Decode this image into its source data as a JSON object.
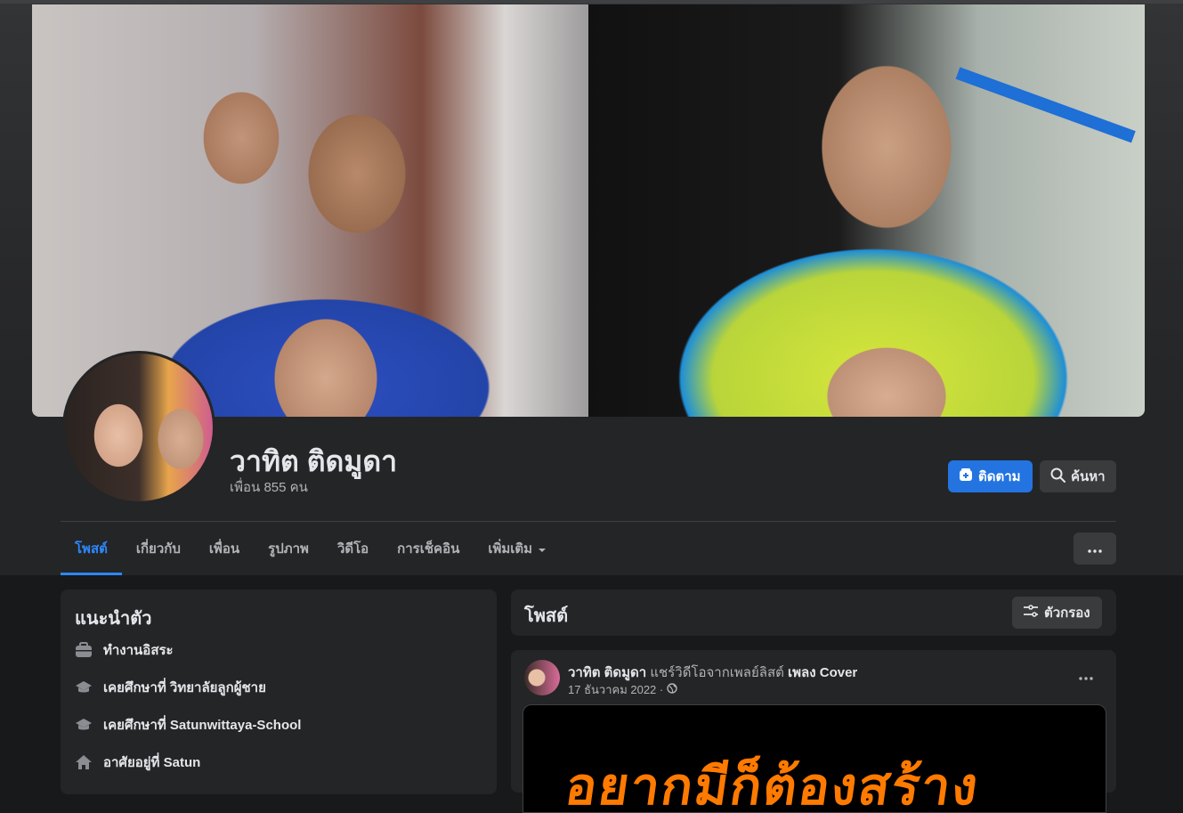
{
  "profile": {
    "name": "วาทิต ติดมูดา",
    "friends_text": "เพื่อน 855 คน"
  },
  "actions": {
    "follow_label": "ติดตาม",
    "search_label": "ค้นหา"
  },
  "tabs": [
    {
      "label": "โพสต์",
      "active": true
    },
    {
      "label": "เกี่ยวกับ"
    },
    {
      "label": "เพื่อน"
    },
    {
      "label": "รูปภาพ"
    },
    {
      "label": "วิดีโอ"
    },
    {
      "label": "การเช็คอิน"
    },
    {
      "label": "เพิ่มเติม"
    }
  ],
  "intro": {
    "title": "แนะนำตัว",
    "items": [
      {
        "icon": "briefcase-icon",
        "text": "ทำงานอิสระ"
      },
      {
        "icon": "graduation-cap-icon",
        "text": "เคยศึกษาที่ วิทยาลัยลูกผู้ชาย"
      },
      {
        "icon": "graduation-cap-icon",
        "text": "เคยศึกษาที่ Satunwittaya-School"
      },
      {
        "icon": "home-icon",
        "text": "อาศัยอยู่ที่ Satun"
      }
    ]
  },
  "posts_section": {
    "title": "โพสต์",
    "filter_label": "ตัวกรอง"
  },
  "post": {
    "author": "วาทิต ติดมูดา",
    "action_text": "แชร์วิดีโอจากเพลย์ลิสต์",
    "target": "เพลง Cover",
    "date": "17 ธันวาคม 2022 ·",
    "media_text": "อยากมีก็ต้องสร้าง"
  },
  "colors": {
    "accent": "#2d88ff",
    "follow_button": "#2374e1",
    "background": "#18191a",
    "card": "#242526"
  }
}
